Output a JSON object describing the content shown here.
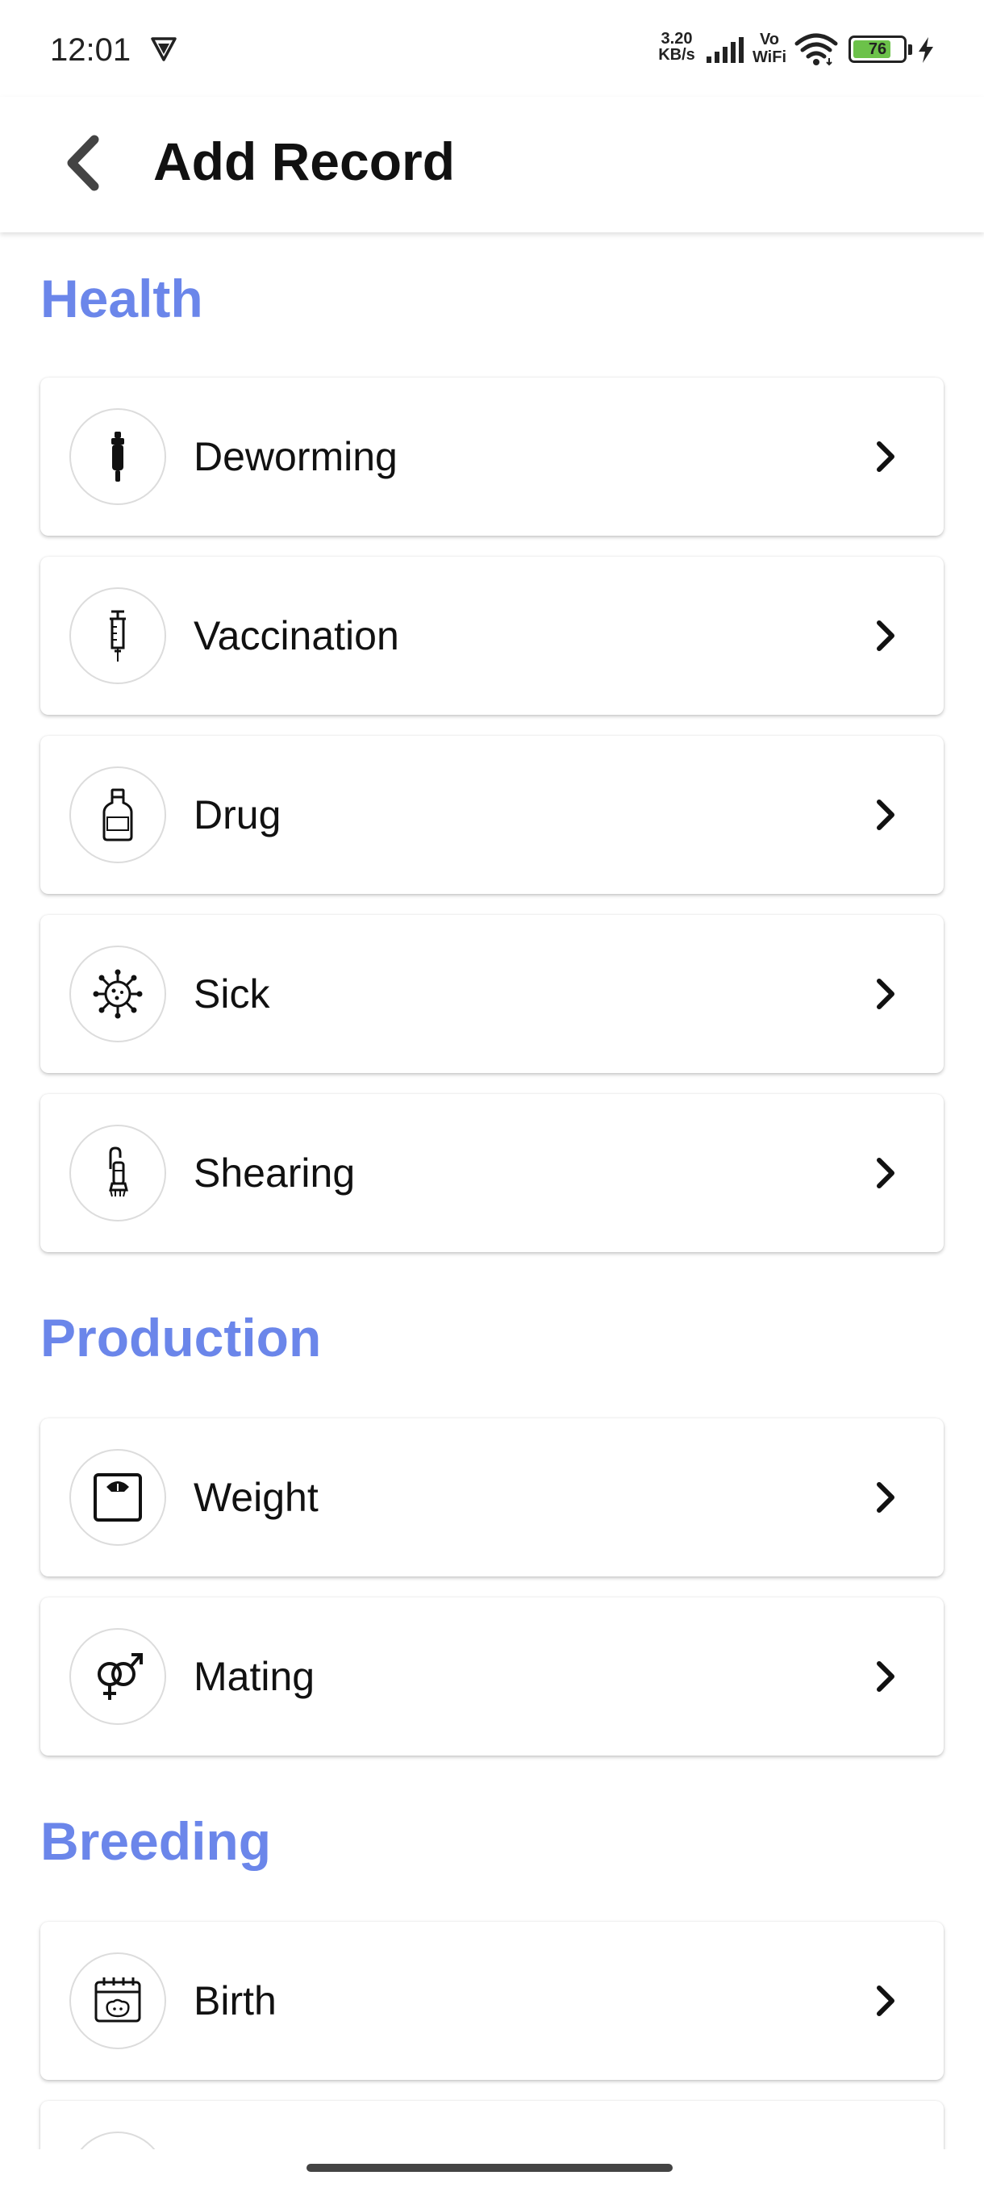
{
  "status_bar": {
    "time": "12:01",
    "net_speed_value": "3.20",
    "net_speed_unit": "KB/s",
    "vo_label": "Vo",
    "wifi_label": "WiFi",
    "battery": "76",
    "battery_level": 0.76
  },
  "app_bar": {
    "title": "Add Record"
  },
  "sections": {
    "health": {
      "title": "Health",
      "items": [
        {
          "label": "Deworming",
          "icon": "dropper-icon"
        },
        {
          "label": "Vaccination",
          "icon": "syringe-icon"
        },
        {
          "label": "Drug",
          "icon": "medicine-bottle-icon"
        },
        {
          "label": "Sick",
          "icon": "virus-icon"
        },
        {
          "label": "Shearing",
          "icon": "shears-icon"
        }
      ]
    },
    "production": {
      "title": "Production",
      "items": [
        {
          "label": "Weight",
          "icon": "scale-icon"
        },
        {
          "label": "Mating",
          "icon": "gender-symbols-icon"
        }
      ]
    },
    "breeding": {
      "title": "Breeding",
      "items": [
        {
          "label": "Birth",
          "icon": "calendar-sheep-icon"
        }
      ]
    }
  },
  "colors": {
    "section_title": "#6b86ea",
    "battery_fill": "#6cc24a"
  }
}
